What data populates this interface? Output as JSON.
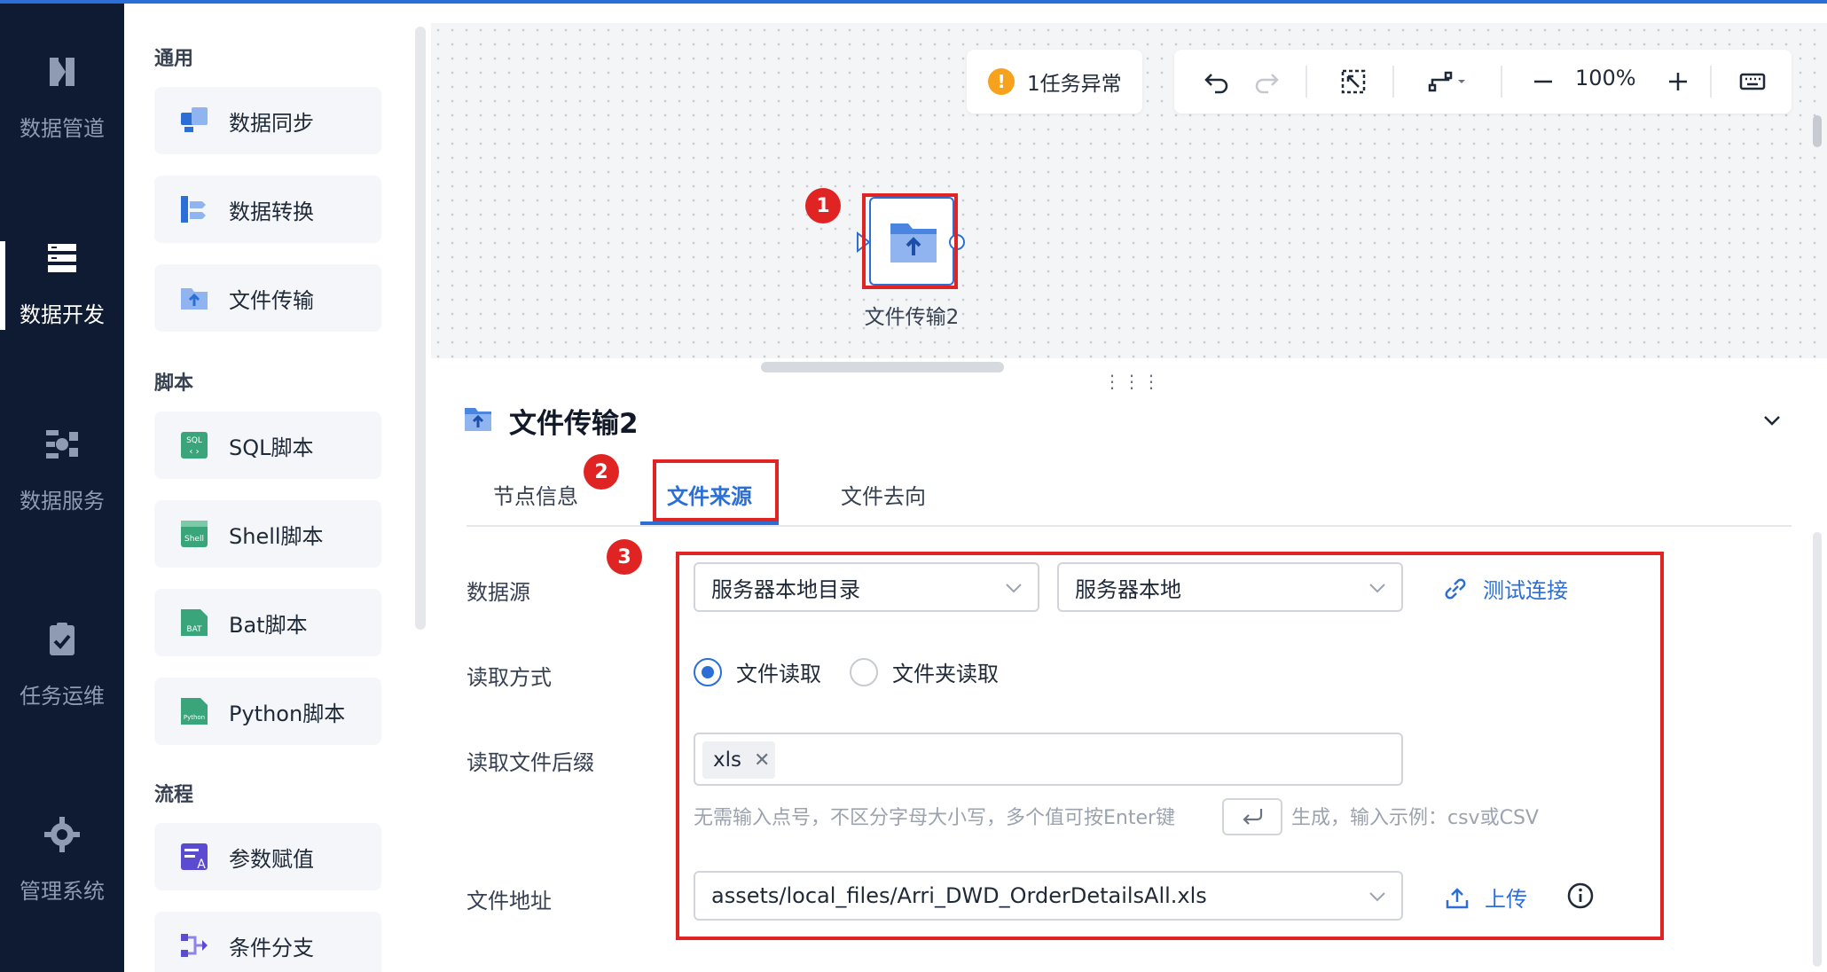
{
  "nav": {
    "items": [
      {
        "label": "数据管道",
        "icon": "pipeline-icon"
      },
      {
        "label": "数据开发",
        "icon": "dev-icon",
        "active": true
      },
      {
        "label": "数据服务",
        "icon": "service-icon"
      },
      {
        "label": "任务运维",
        "icon": "ops-icon"
      },
      {
        "label": "管理系统",
        "icon": "gear-icon"
      }
    ]
  },
  "components": {
    "sections": [
      {
        "title": "通用",
        "items": [
          "数据同步",
          "数据转换",
          "文件传输"
        ]
      },
      {
        "title": "脚本",
        "items": [
          "SQL脚本",
          "Shell脚本",
          "Bat脚本",
          "Python脚本"
        ]
      },
      {
        "title": "流程",
        "items": [
          "参数赋值",
          "条件分支"
        ]
      }
    ]
  },
  "canvas": {
    "alert_count_text": "1任务异常",
    "zoom_level": "100%",
    "node_label": "文件传输2",
    "badges": [
      "1",
      "2",
      "3"
    ]
  },
  "detail": {
    "title": "文件传输2",
    "tabs": [
      "节点信息",
      "文件来源",
      "文件去向"
    ],
    "active_tab": "文件来源",
    "form": {
      "datasource_label": "数据源",
      "datasource_type": "服务器本地目录",
      "datasource_conn": "服务器本地",
      "test_link": "测试连接",
      "read_mode_label": "读取方式",
      "read_mode_options": [
        "文件读取",
        "文件夹读取"
      ],
      "read_mode_selected": "文件读取",
      "suffix_label": "读取文件后缀",
      "suffix_tags": [
        "xls"
      ],
      "hint_before": "无需输入点号，不区分字母大小写，多个值可按Enter键",
      "hint_after": "生成，输入示例：csv或CSV",
      "file_path_label": "文件地址",
      "file_path_value": "assets/local_files/Arri_DWD_OrderDetailsAll.xls",
      "upload_label": "上传"
    }
  },
  "colors": {
    "accent": "#2b6fd6",
    "highlight": "#e02424",
    "nav_bg": "#0f1b33",
    "warning": "#f7a21c"
  }
}
